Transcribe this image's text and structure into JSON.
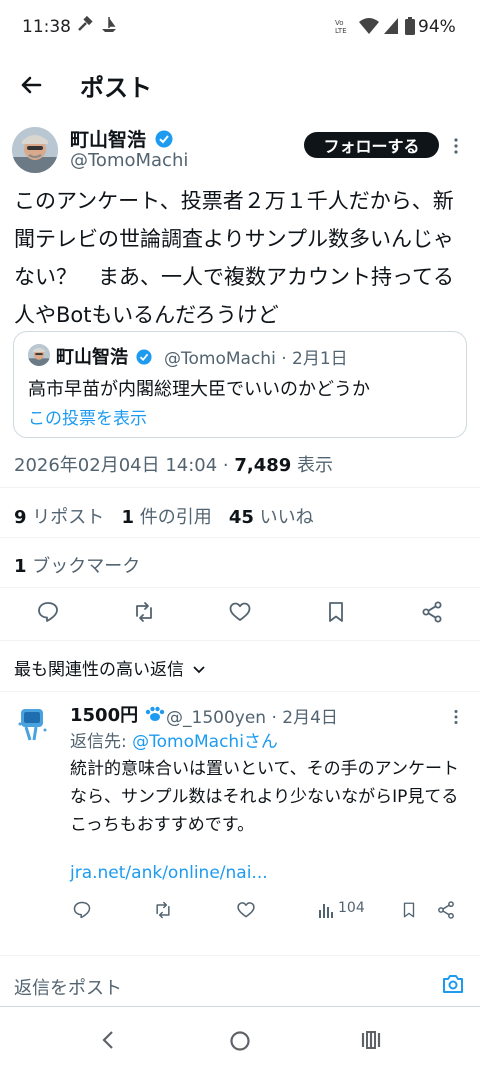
{
  "status_bar": {
    "time": "11:38",
    "battery": "94%"
  },
  "header": {
    "title": "ポスト"
  },
  "post": {
    "author_name": "町山智浩",
    "author_handle": "@TomoMachi",
    "follow_label": "フォローする",
    "text": "このアンケート、投票者２万１千人だから、新聞テレビの世論調査よりサンプル数多いんじゃない？　まあ、一人で複数アカウント持ってる人やBotもいるんだろうけど",
    "quote": {
      "author_name": "町山智浩",
      "author_handle_date": "@TomoMachi · 2月1日",
      "text": "高市早苗が内閣総理大臣でいいのかどうか",
      "link_label": "この投票を表示"
    },
    "timestamp": "2026年02月04日 14:04 · ",
    "views_count": "7,489",
    "views_label": " 表示",
    "reposts_count": "9",
    "reposts_label": " リポスト",
    "quotes_count": "1",
    "quotes_label": " 件の引用",
    "likes_count": "45",
    "likes_label": " いいね",
    "bookmarks_count": "1",
    "bookmarks_label": " ブックマーク"
  },
  "sort": {
    "label": "最も関連性の高い返信"
  },
  "reply": {
    "author_name": "1500円",
    "author_handle_date": "@_1500yen · 2月4日",
    "reply_to_prefix": "返信先: ",
    "reply_to_handle": "@TomoMachiさん",
    "text": "統計的意味合いは置いといて、その手のアンケートなら、サンプル数はそれより少ないながらIP見てるこっちもおすすめです。",
    "link": "jra.net/ank/online/nai...",
    "views": "104"
  },
  "composer": {
    "placeholder": "返信をポスト"
  },
  "colors": {
    "accent": "#1d9bf0",
    "text": "#0f1419",
    "secondary": "#536471"
  }
}
